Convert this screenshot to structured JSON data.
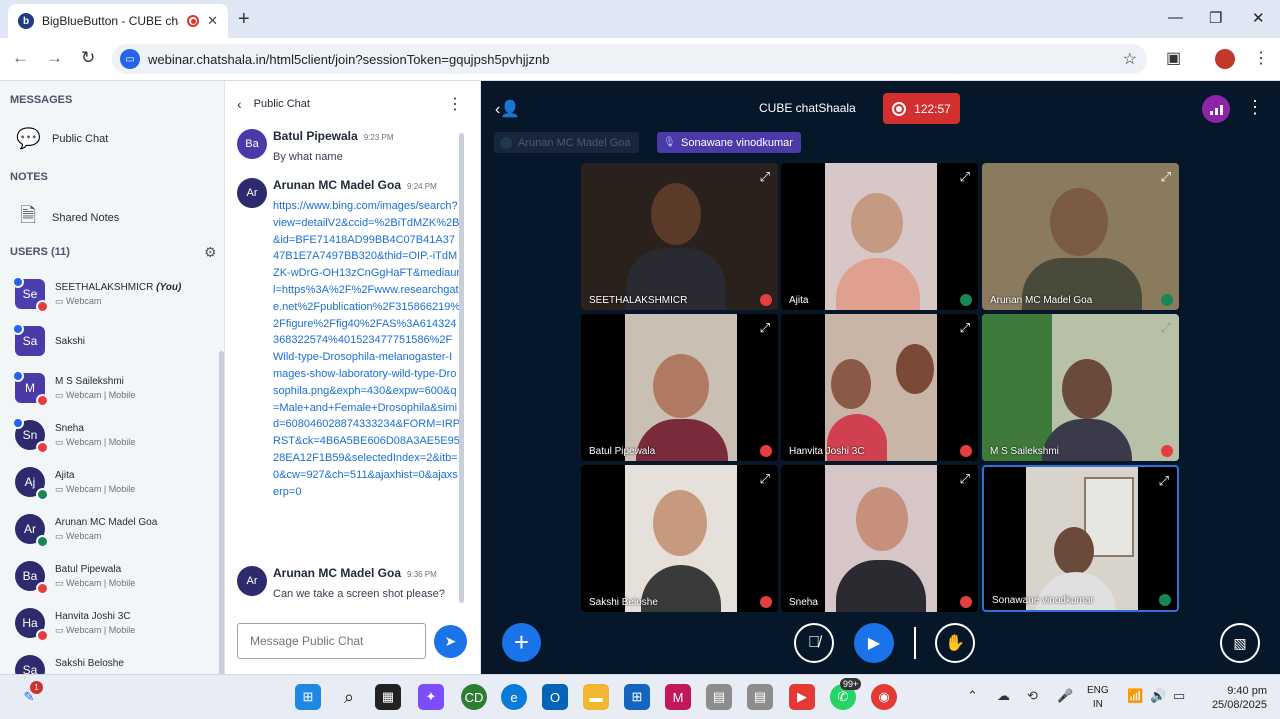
{
  "browser": {
    "tab_title": "BigBlueButton - CUBE chatS",
    "tab_icon": "b",
    "url": "webinar.chatshala.in/html5client/join?sessionToken=gqujpsh5pvhjjznb"
  },
  "sidebar": {
    "messages_title": "MESSAGES",
    "public_chat_label": "Public Chat",
    "notes_title": "NOTES",
    "shared_notes_label": "Shared Notes",
    "users_title": "USERS (11)",
    "users": [
      {
        "initials": "Se",
        "name": "SEETHALAKSHMICR",
        "tag": "(You)",
        "device": "▭ Webcam"
      },
      {
        "initials": "Sa",
        "name": "Sakshi",
        "device": ""
      },
      {
        "initials": "M",
        "name": "M S Sailekshmi",
        "device": "▭ Webcam | Mobile"
      },
      {
        "initials": "Sn",
        "name": "Sneha",
        "device": "▭ Webcam | Mobile"
      },
      {
        "initials": "Aj",
        "name": "Ajita",
        "device": "▭ Webcam | Mobile"
      },
      {
        "initials": "Ar",
        "name": "Arunan MC Madel Goa",
        "device": "▭ Webcam"
      },
      {
        "initials": "Ba",
        "name": "Batul Pipewala",
        "device": "▭ Webcam | Mobile"
      },
      {
        "initials": "Ha",
        "name": "Hanvita Joshi 3C",
        "device": "▭ Webcam | Mobile"
      },
      {
        "initials": "Sa",
        "name": "Sakshi Beloshe",
        "device": ""
      }
    ]
  },
  "chat": {
    "title": "Public Chat",
    "messages": [
      {
        "initials": "Ba",
        "author": "Batul Pipewala",
        "time": "9:23 PM",
        "text": "By what name"
      },
      {
        "initials": "Ar",
        "author": "Arunan MC Madel Goa",
        "time": "9:24 PM",
        "text": "https://www.bing.com/images/search?view=detailV2&ccid=%2BiTdMZK%2B&id=BFE71418AD99BB4C07B41A3747B1E7A7497BB320&thid=OIP.-iTdMZK-wDrG-OH13zCnGgHaFT&mediaurl=https%3A%2F%2Fwww.researchgate.net%2Fpublication%2F315866219%2Ffigure%2Ffig40%2FAS%3A614324368322574%401523477751586%2FWild-type-Drosophila-melanogaster-Images-show-laboratory-wild-type-Drosophila.png&exph=430&expw=600&q=Male+and+Female+Drosophila&simid=608046028874333234&FORM=IRPRST&ck=4B6A5BE606D08A3AE5E9528EA12F1B59&selectedIndex=2&itb=0&cw=927&ch=511&ajaxhist=0&ajaxserp=0"
      },
      {
        "initials": "Ar",
        "author": "Arunan MC Madel Goa",
        "time": "9:36 PM",
        "text": "Can we take a screen shot please?"
      }
    ],
    "input_placeholder": "Message Public Chat"
  },
  "meeting": {
    "title": "CUBE chatShaala",
    "recording_time": "122:57",
    "talkers": [
      "Arunan MC Madel Goa",
      "Sonawane vinodkumar"
    ],
    "tiles": [
      {
        "name": "SEETHALAKSHMICR"
      },
      {
        "name": "Ajita"
      },
      {
        "name": "Arunan MC Madel Goa"
      },
      {
        "name": "Batul Pipewala"
      },
      {
        "name": "Hanvita Joshi 3C"
      },
      {
        "name": "M S Sailekshmi"
      },
      {
        "name": "Sakshi Beloshe"
      },
      {
        "name": "Sneha"
      },
      {
        "name": "Sonawane vinodkumar"
      }
    ]
  },
  "taskbar": {
    "notification_badge": "1",
    "whatsapp_badge": "99+",
    "lang_top": "ENG",
    "lang_bottom": "IN",
    "time": "9:40 pm",
    "date": "25/08/2025"
  },
  "colors": {
    "meeting_bg": "#06172a",
    "accent_blue": "#1a73e8",
    "recording_red": "#d32f2f",
    "avatar_purple": "#4a3aa8"
  }
}
